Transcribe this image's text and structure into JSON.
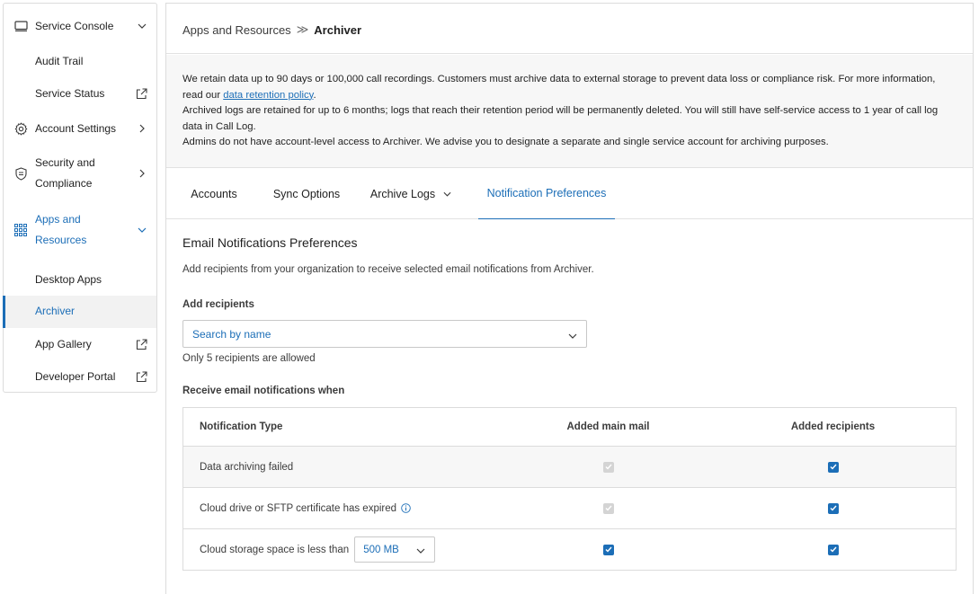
{
  "sidebar": {
    "items": [
      {
        "label": "Service Console",
        "icon": "monitor-icon"
      },
      {
        "label": "Audit Trail"
      },
      {
        "label": "Service Status",
        "icon": "external-link-icon"
      },
      {
        "label": "Account Settings",
        "icon": "gear-icon"
      },
      {
        "label": "Security and",
        "label2": "Compliance",
        "icon": "shield-icon"
      },
      {
        "label": "Apps and",
        "label2": "Resources",
        "icon": "grid-icon"
      },
      {
        "label": "Desktop Apps"
      },
      {
        "label": "Archiver"
      },
      {
        "label": "App Gallery",
        "icon": "external-link-icon"
      },
      {
        "label": "Developer Portal",
        "icon": "external-link-icon"
      }
    ]
  },
  "breadcrumb": {
    "parent": "Apps and Resources",
    "separator": "≫",
    "current": "Archiver"
  },
  "notice": {
    "line1_pre": "We retain data up to 90 days or 100,000 call recordings. Customers must archive data to external storage to prevent data loss or compliance risk. For more information, read our ",
    "line1_link": "data retention policy",
    "line1_post": ".",
    "line2": "Archived logs are retained for up to 6 months; logs that reach their retention period will be permanently deleted. You will still have self-service access to 1 year of call log data in Call Log.",
    "line3": "Admins do not have account-level access to Archiver. We advise you to designate a separate and single service account for archiving purposes."
  },
  "tabs": [
    {
      "label": "Accounts"
    },
    {
      "label": "Sync Options"
    },
    {
      "label": "Archive Logs"
    },
    {
      "label": "Notification Preferences",
      "active": true
    }
  ],
  "email": {
    "title": "Email Notifications Preferences",
    "description": "Add recipients from your organization to receive selected email notifications from Archiver.",
    "add_label": "Add recipients",
    "search_placeholder": "Search by name",
    "hint": "Only 5 recipients are allowed",
    "receive_label": "Receive email notifications when"
  },
  "table": {
    "headers": [
      "Notification Type",
      "Added main mail",
      "Added recipients"
    ],
    "rows": [
      {
        "type": "Data archiving failed",
        "main_checked": true,
        "main_disabled": true,
        "recipients_checked": true
      },
      {
        "type": "Cloud drive or SFTP certificate has expired",
        "main_checked": true,
        "main_disabled": true,
        "recipients_checked": true
      },
      {
        "type": "Cloud storage space is less than",
        "threshold": "500 MB",
        "main_checked": true,
        "main_disabled": false,
        "recipients_checked": true
      }
    ]
  },
  "colors": {
    "accent": "#1c6eb7",
    "disabled": "#d4d4d4",
    "border": "#dcdcdc",
    "shade": "#f7f7f7"
  }
}
